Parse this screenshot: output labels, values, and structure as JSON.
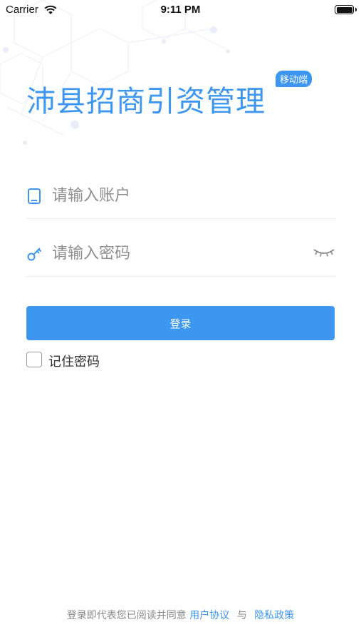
{
  "status_bar": {
    "carrier": "Carrier",
    "time": "9:11 PM",
    "battery_level": 1.0
  },
  "header": {
    "title": "沛县招商引资管理",
    "badge": "移动端"
  },
  "form": {
    "account": {
      "placeholder": "请输入账户",
      "value": ""
    },
    "password": {
      "placeholder": "请输入密码",
      "value": ""
    },
    "login_label": "登录",
    "remember_label": "记住密码",
    "remember_checked": false
  },
  "footer": {
    "prefix": "登录即代表您已阅读并同意",
    "user_agreement": "用户协议",
    "and": "与",
    "privacy_policy": "隐私政策"
  },
  "colors": {
    "accent": "#3d97f0",
    "placeholder": "#8e8e8e",
    "divider": "#ebebeb"
  },
  "icons": [
    "wifi-icon",
    "battery-icon",
    "phone-icon",
    "key-icon",
    "eye-closed-icon"
  ]
}
